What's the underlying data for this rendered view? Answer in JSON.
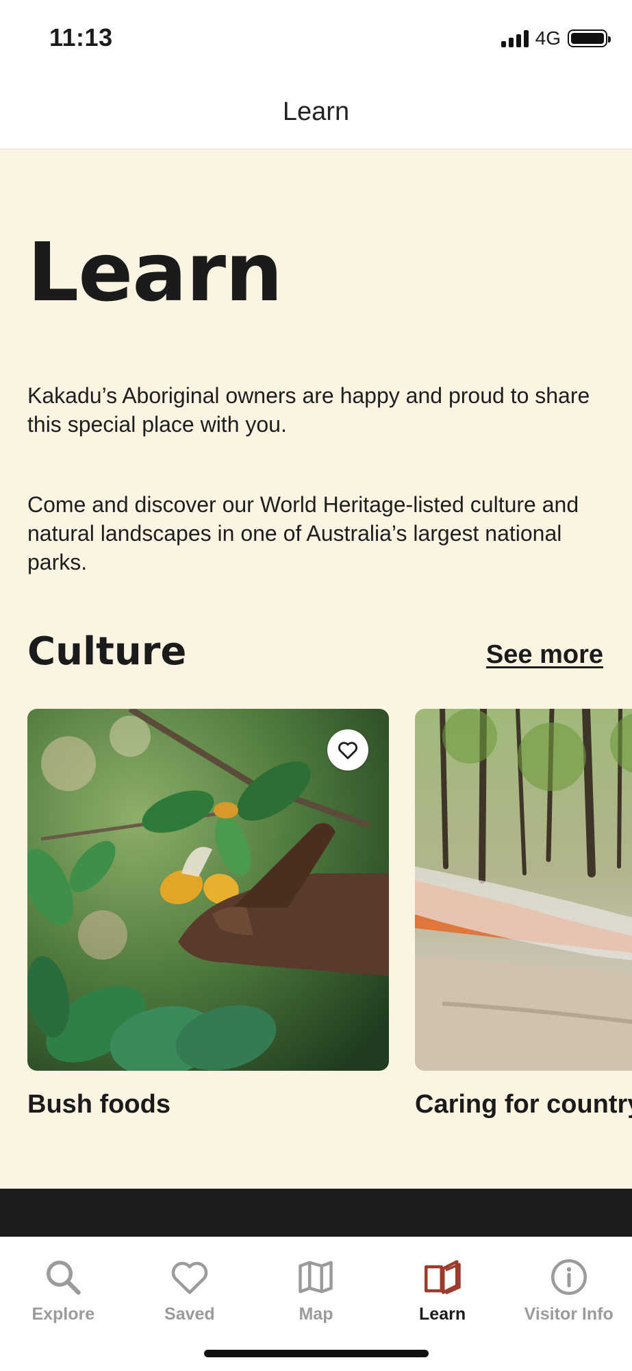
{
  "status_bar": {
    "time": "11:13",
    "network": "4G"
  },
  "header": {
    "title": "Learn"
  },
  "hero": {
    "title": "Learn",
    "paragraphs": [
      "Kakadu’s Aboriginal owners are happy and proud to share this special place with you.",
      "Come and discover our World Heritage-listed culture and natural landscapes in one of Australia’s largest national parks."
    ]
  },
  "culture": {
    "title": "Culture",
    "see_more": "See more",
    "cards": [
      {
        "title": "Bush foods",
        "image": "hand-picking-yellow-bush-fruit",
        "favorite_icon": "heart-outline-icon"
      },
      {
        "title": "Caring for country",
        "image": "ranger-walking-past-controlled-burn"
      }
    ]
  },
  "tab_bar": {
    "active": "Learn",
    "active_color": "#9c3a2c",
    "inactive_color": "#9b9b9b",
    "tabs": [
      {
        "label": "Explore",
        "icon": "search-icon"
      },
      {
        "label": "Saved",
        "icon": "heart-icon"
      },
      {
        "label": "Map",
        "icon": "map-icon"
      },
      {
        "label": "Learn",
        "icon": "book-icon"
      },
      {
        "label": "Visitor Info",
        "icon": "info-icon"
      }
    ]
  }
}
